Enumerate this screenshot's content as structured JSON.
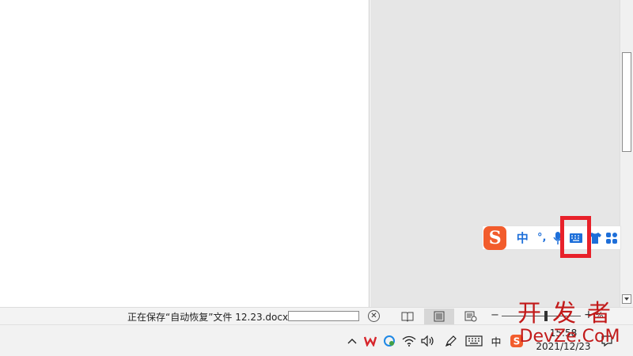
{
  "status_bar": {
    "save_status": "正在保存“自动恢复”文件 12.23.docx:",
    "save_progress": 0.0,
    "zoom_minus": "−",
    "zoom_plus": "+",
    "zoom_level": "%"
  },
  "ime_toolbar": {
    "logo": "S",
    "mode": "中",
    "punctuation": "°,",
    "icons": [
      "sogou-logo",
      "microphone-icon",
      "keyboard-icon",
      "skin-icon",
      "apps-grid-icon"
    ]
  },
  "taskbar": {
    "input_indicator": "中",
    "time": "15:58",
    "date": "2021/12/23",
    "icons": [
      "chevron-up-icon",
      "wps-icon",
      "sync-icon",
      "wifi-icon",
      "speaker-icon",
      "pen-icon",
      "keyboard-icon",
      "sogou-icon",
      "notification-icon"
    ]
  },
  "watermark": {
    "chinese": "开发者",
    "english": "DevZe.CoM",
    "color": "#c21a1a"
  },
  "colors": {
    "highlight": "#e8212a",
    "sogou_orange": "#f25c2c",
    "ime_blue": "#1e6fd9"
  }
}
